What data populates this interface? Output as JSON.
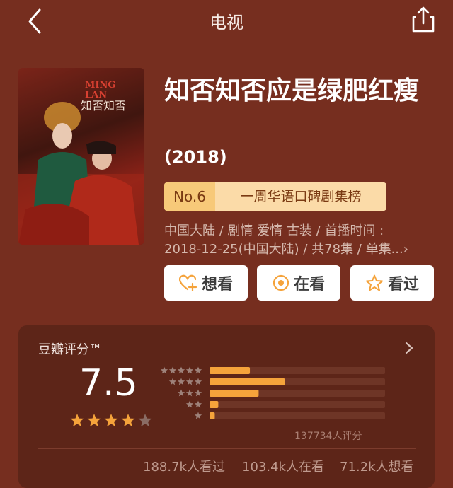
{
  "nav": {
    "title": "电视"
  },
  "show": {
    "title": "知否知否应是绿肥红瘦",
    "year": "(2018)",
    "poster_text_en": "MING LAN",
    "poster_text_cn": "知否知否",
    "rank_no": "No.6",
    "rank_label": "一周华语口碑剧集榜",
    "meta_line1": "中国大陆 / 剧情 爱情 古装 / 首播时间 :",
    "meta_line2": "2018-12-25(中国大陆) / 共78集 / 单集...",
    "meta_more": "›"
  },
  "actions": [
    {
      "label": "想看",
      "icon": "heart-plus-icon"
    },
    {
      "label": "在看",
      "icon": "target-circle-icon"
    },
    {
      "label": "看过",
      "icon": "star-outline-icon"
    }
  ],
  "rating": {
    "label": "豆瓣评分™",
    "score": "7.5",
    "stars_value": 4,
    "stars_max": 5,
    "distribution": [
      {
        "stars": 5,
        "fraction": 0.23
      },
      {
        "stars": 4,
        "fraction": 0.43
      },
      {
        "stars": 3,
        "fraction": 0.28
      },
      {
        "stars": 2,
        "fraction": 0.05
      },
      {
        "stars": 1,
        "fraction": 0.03
      }
    ],
    "count_text": "137734人评分",
    "stats": [
      "188.7k人看过",
      "103.4k人在看",
      "71.2k人想看"
    ]
  },
  "colors": {
    "background": "#762e1f",
    "panel": "#5d2518",
    "accent": "#f5a33b",
    "rank_bg": "#fbdba8"
  }
}
